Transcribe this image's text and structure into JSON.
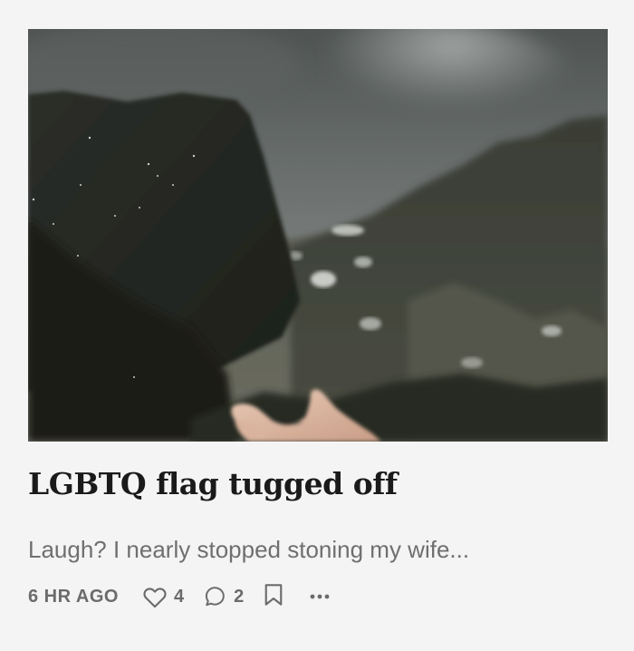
{
  "post": {
    "title": "LGBTQ flag tugged off",
    "excerpt": "Laugh? I nearly stopped stoning my wife...",
    "timestamp": "6 HR AGO",
    "likes": "4",
    "comments": "2"
  },
  "image": {
    "subject": "mountain-landscape-with-hand"
  },
  "icons": {
    "like": "heart-icon",
    "comment": "comment-bubble-icon",
    "bookmark": "bookmark-icon",
    "more": "ellipsis-icon"
  },
  "colors": {
    "background": "#f4f4f4",
    "title": "#1a1a1a",
    "muted": "#6b6b6b"
  }
}
